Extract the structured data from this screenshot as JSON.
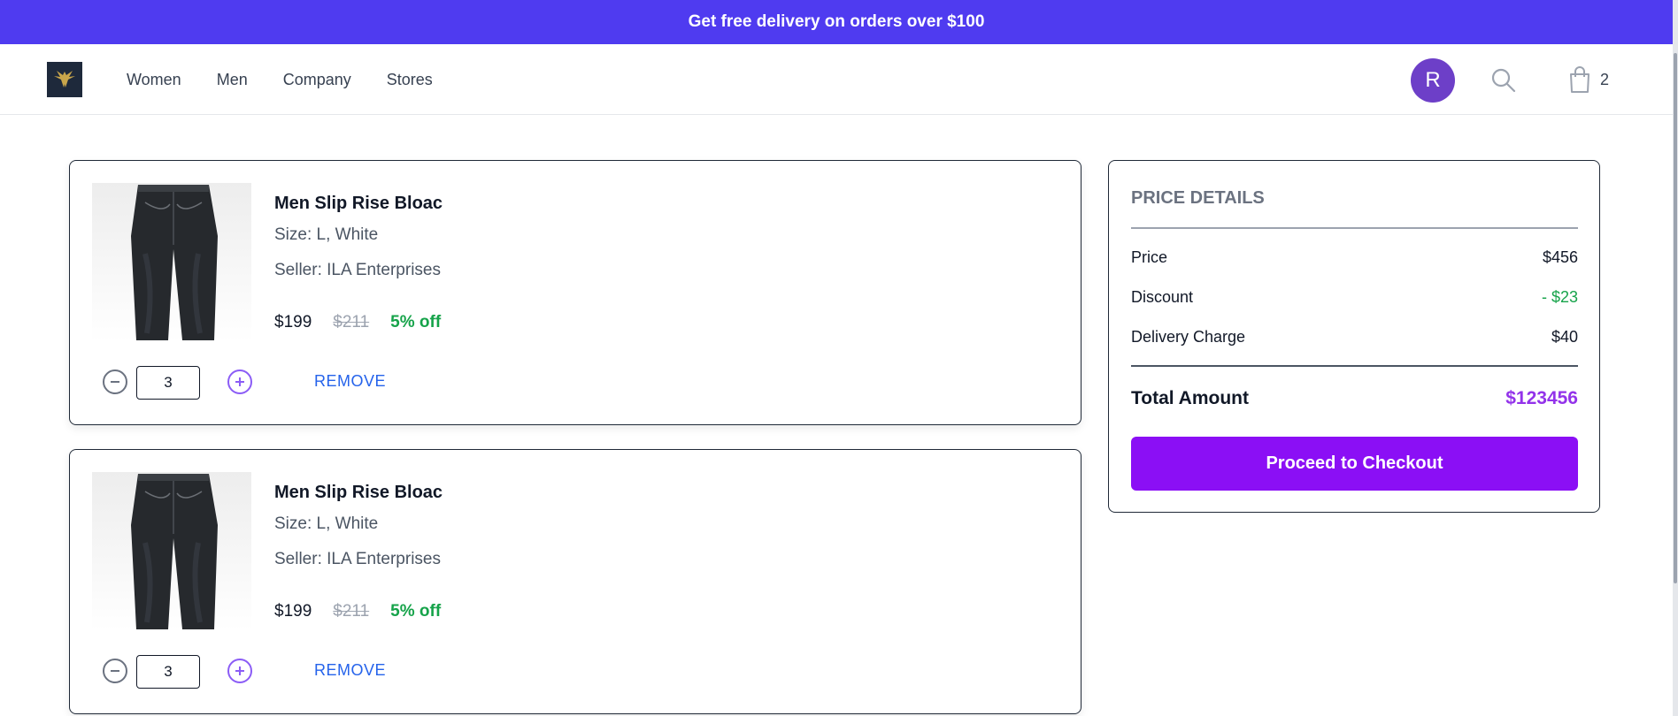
{
  "promo": {
    "text": "Get free delivery on orders over $100"
  },
  "header": {
    "nav": [
      "Women",
      "Men",
      "Company",
      "Stores"
    ],
    "avatar_initial": "R",
    "cart_count": "2"
  },
  "cart_items": [
    {
      "name": "Men Slip Rise Bloac",
      "size": "Size: L, White",
      "seller": "Seller: ILA Enterprises",
      "price": "$199",
      "original_price": "$211",
      "discount": "5% off",
      "quantity": "3",
      "remove_label": "REMOVE"
    },
    {
      "name": "Men Slip Rise Bloac",
      "size": "Size: L, White",
      "seller": "Seller: ILA Enterprises",
      "price": "$199",
      "original_price": "$211",
      "discount": "5% off",
      "quantity": "3",
      "remove_label": "REMOVE"
    }
  ],
  "summary": {
    "title": "PRICE DETAILS",
    "price_label": "Price",
    "price_value": "$456",
    "discount_label": "Discount",
    "discount_value": "- $23",
    "delivery_label": "Delivery Charge",
    "delivery_value": "$40",
    "total_label": "Total Amount",
    "total_value": "$123456",
    "checkout_label": "Proceed to Checkout"
  },
  "colors": {
    "promo_bg": "#4f3bf0",
    "avatar_bg": "#6d3fc8",
    "checkout_bg": "#8b0ff5",
    "discount_green": "#16a34a",
    "total_purple": "#9333ea",
    "link_blue": "#2563eb"
  },
  "icons": [
    "brand-logo-icon",
    "search-icon",
    "shopping-bag-icon",
    "minus-icon",
    "plus-icon"
  ]
}
